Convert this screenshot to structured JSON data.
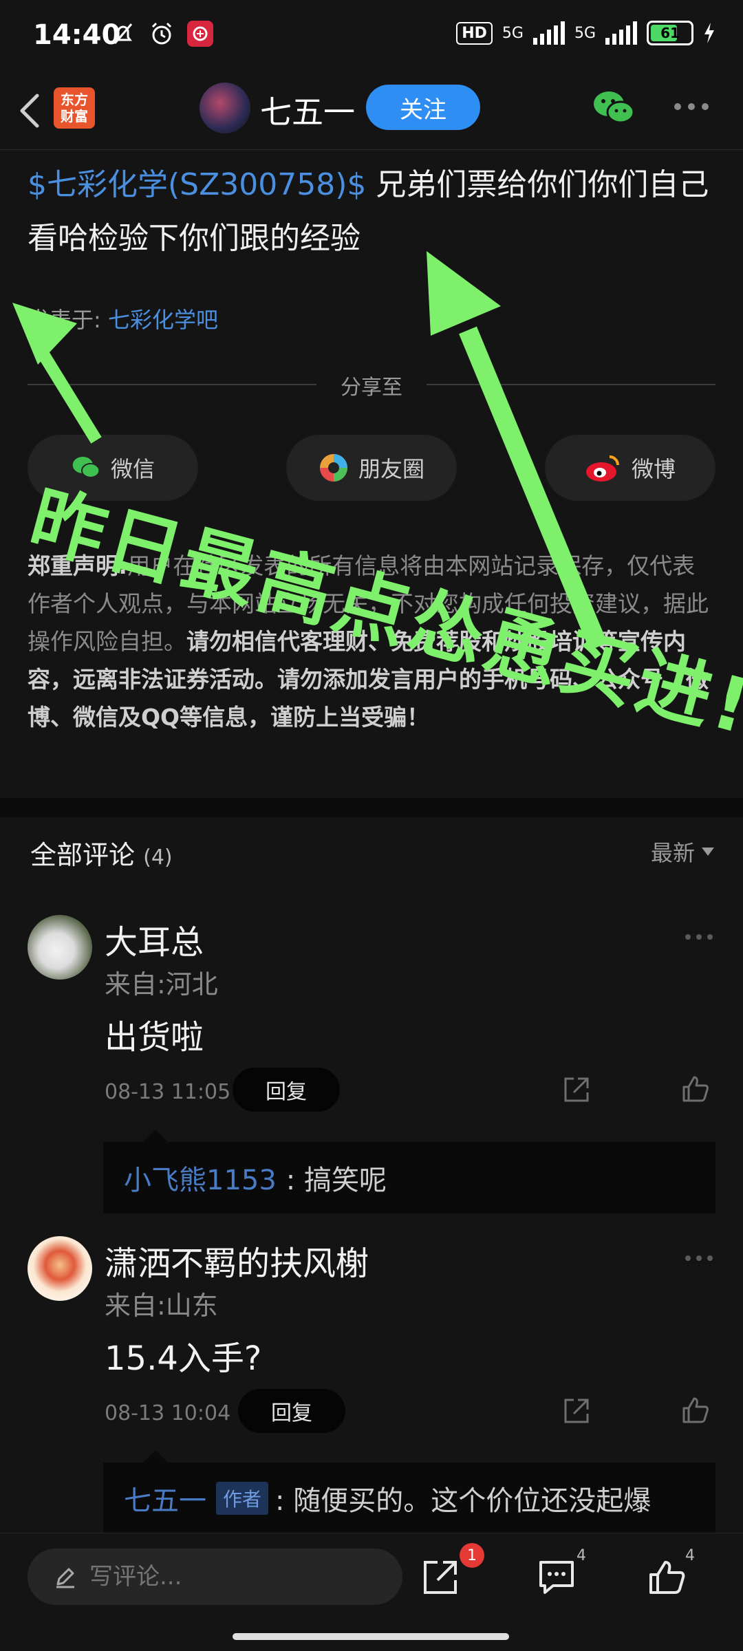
{
  "status_bar": {
    "time": "14:40",
    "hd_label": "HD",
    "net1": "5G",
    "net2": "5G",
    "battery": "61",
    "battery_color": "#4cd964"
  },
  "nav": {
    "app_logo_line1": "东方",
    "app_logo_line2": "财富",
    "username": "七五一",
    "follow_label": "关注",
    "accent": "#2f8ef4"
  },
  "post": {
    "stock_link": "$七彩化学(SZ300758)$",
    "text": " 兄弟们票给你们你们自己看哈检验下你们跟的经验",
    "published_prefix": "发表于:",
    "published_bar": "七彩化学吧"
  },
  "share": {
    "title": "分享至",
    "wechat": "微信",
    "moments": "朋友圈",
    "weibo": "微博"
  },
  "disclaimer": {
    "label": "郑重声明:",
    "text1": "用户在社区发表的所有信息将由本网站记录保存，仅代表作者个人观点，与本网站立场无关，不对您构成任何投资建议，据此操作风险自担。",
    "text2": "请勿相信代客理财、免费荐股和炒股培训等宣传内容，远离非法证券活动。请勿添加发言用户的手机号码、公众号、微博、微信及QQ等信息，谨防上当受骗！"
  },
  "comments": {
    "header": "全部评论",
    "count": "(4)",
    "sort": "最新",
    "items": [
      {
        "name": "大耳总",
        "location": "来自:河北",
        "body": "出货啦",
        "time": "08-13 11:05",
        "reply_label": "回复",
        "reply_name": "小飞熊1153",
        "reply_text": ":  搞笑呢"
      },
      {
        "name": "潇洒不羁的扶风榭",
        "location": "来自:山东",
        "body": "15.4入手?",
        "time": "08-13 10:04",
        "reply_label": "回复",
        "reply_name": "七五一",
        "reply_tag": "作者",
        "reply_text": ":  随便买的。这个价位还没起爆"
      }
    ]
  },
  "bottom_bar": {
    "input_placeholder": "写评论...",
    "share_badge": "1",
    "comment_count": "4",
    "like_count": "4"
  },
  "overlay": {
    "text": "昨日最高点怂恿买进!",
    "color": "#7ef06c"
  }
}
